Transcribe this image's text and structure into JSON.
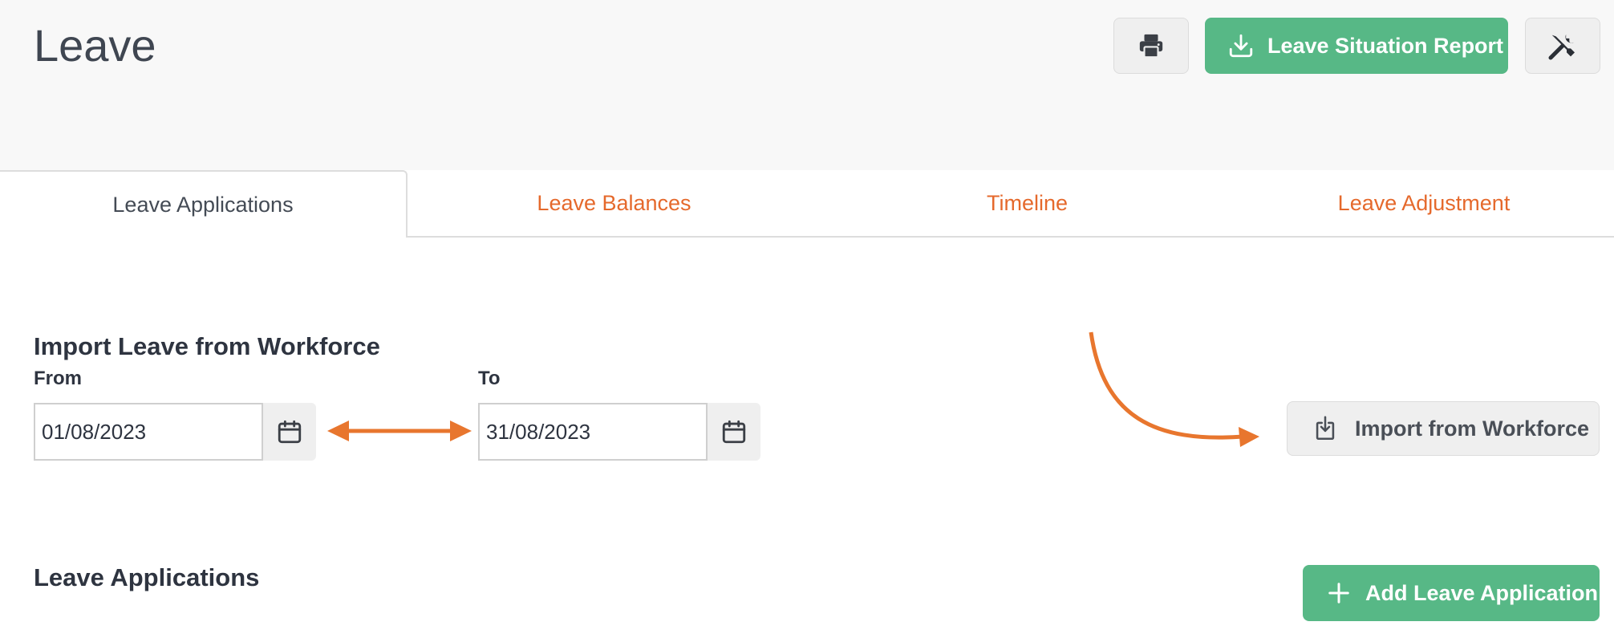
{
  "page": {
    "title": "Leave"
  },
  "header": {
    "report_button": "Leave Situation Report",
    "icons": {
      "print": "printer-icon",
      "download": "download-icon",
      "tools": "tools-icon"
    }
  },
  "tabs": [
    {
      "label": "Leave Applications",
      "active": true
    },
    {
      "label": "Leave Balances",
      "active": false
    },
    {
      "label": "Timeline",
      "active": false
    },
    {
      "label": "Leave Adjustment",
      "active": false
    }
  ],
  "import_section": {
    "title": "Import Leave from Workforce",
    "from_label": "From",
    "from_value": "01/08/2023",
    "to_label": "To",
    "to_value": "31/08/2023",
    "import_button": "Import from Workforce",
    "calendar_icon": "calendar-icon",
    "import_icon": "import-icon"
  },
  "applications_section": {
    "title": "Leave Applications",
    "add_button": "Add Leave Application",
    "add_icon": "plus-icon"
  },
  "colors": {
    "accent_green": "#57b886",
    "tab_orange": "#e5692c",
    "annotation_orange": "#e8762e"
  }
}
